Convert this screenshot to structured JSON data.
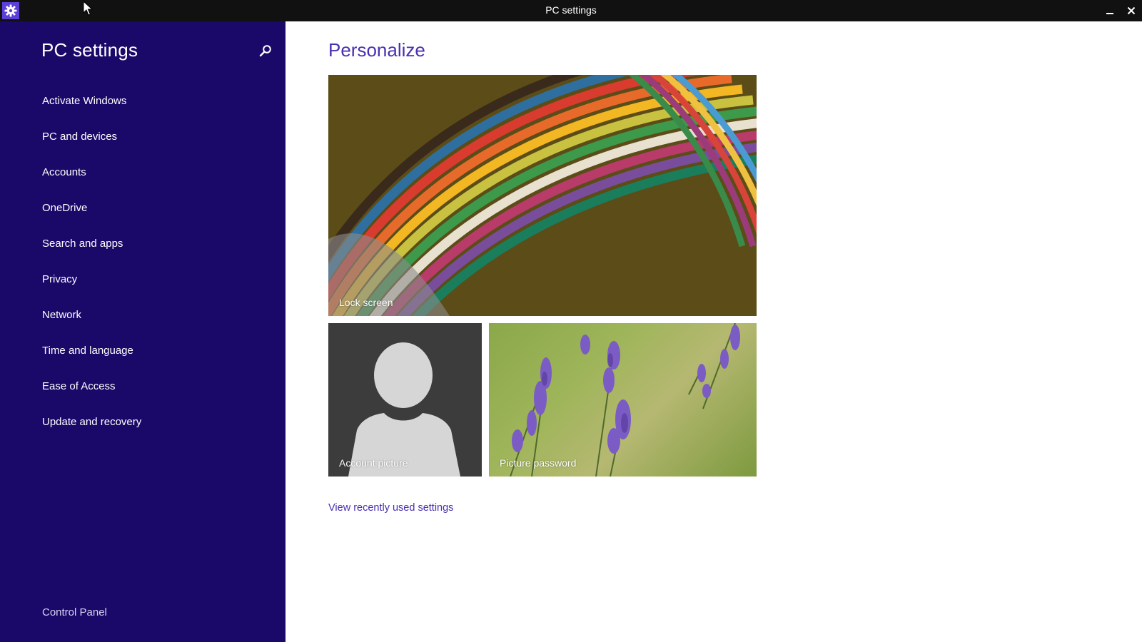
{
  "window": {
    "title": "PC settings",
    "minimize_icon": "minimize-icon",
    "close_icon": "close-icon",
    "app_icon": "gear-icon"
  },
  "sidebar": {
    "title": "PC settings",
    "search_icon": "search-icon",
    "items": [
      {
        "label": "Activate Windows"
      },
      {
        "label": "PC and devices"
      },
      {
        "label": "Accounts"
      },
      {
        "label": "OneDrive"
      },
      {
        "label": "Search and apps"
      },
      {
        "label": "Privacy"
      },
      {
        "label": "Network"
      },
      {
        "label": "Time and language"
      },
      {
        "label": "Ease of Access"
      },
      {
        "label": "Update and recovery"
      }
    ],
    "footer_link": "Control Panel"
  },
  "main": {
    "title": "Personalize",
    "tiles": {
      "lock_screen": "Lock screen",
      "account_picture": "Account picture",
      "picture_password": "Picture password"
    },
    "recent_link": "View recently used settings"
  },
  "colors": {
    "sidebar_bg": "#1a0969",
    "accent": "#4a2fb0",
    "titlebar_bg": "#111111"
  }
}
